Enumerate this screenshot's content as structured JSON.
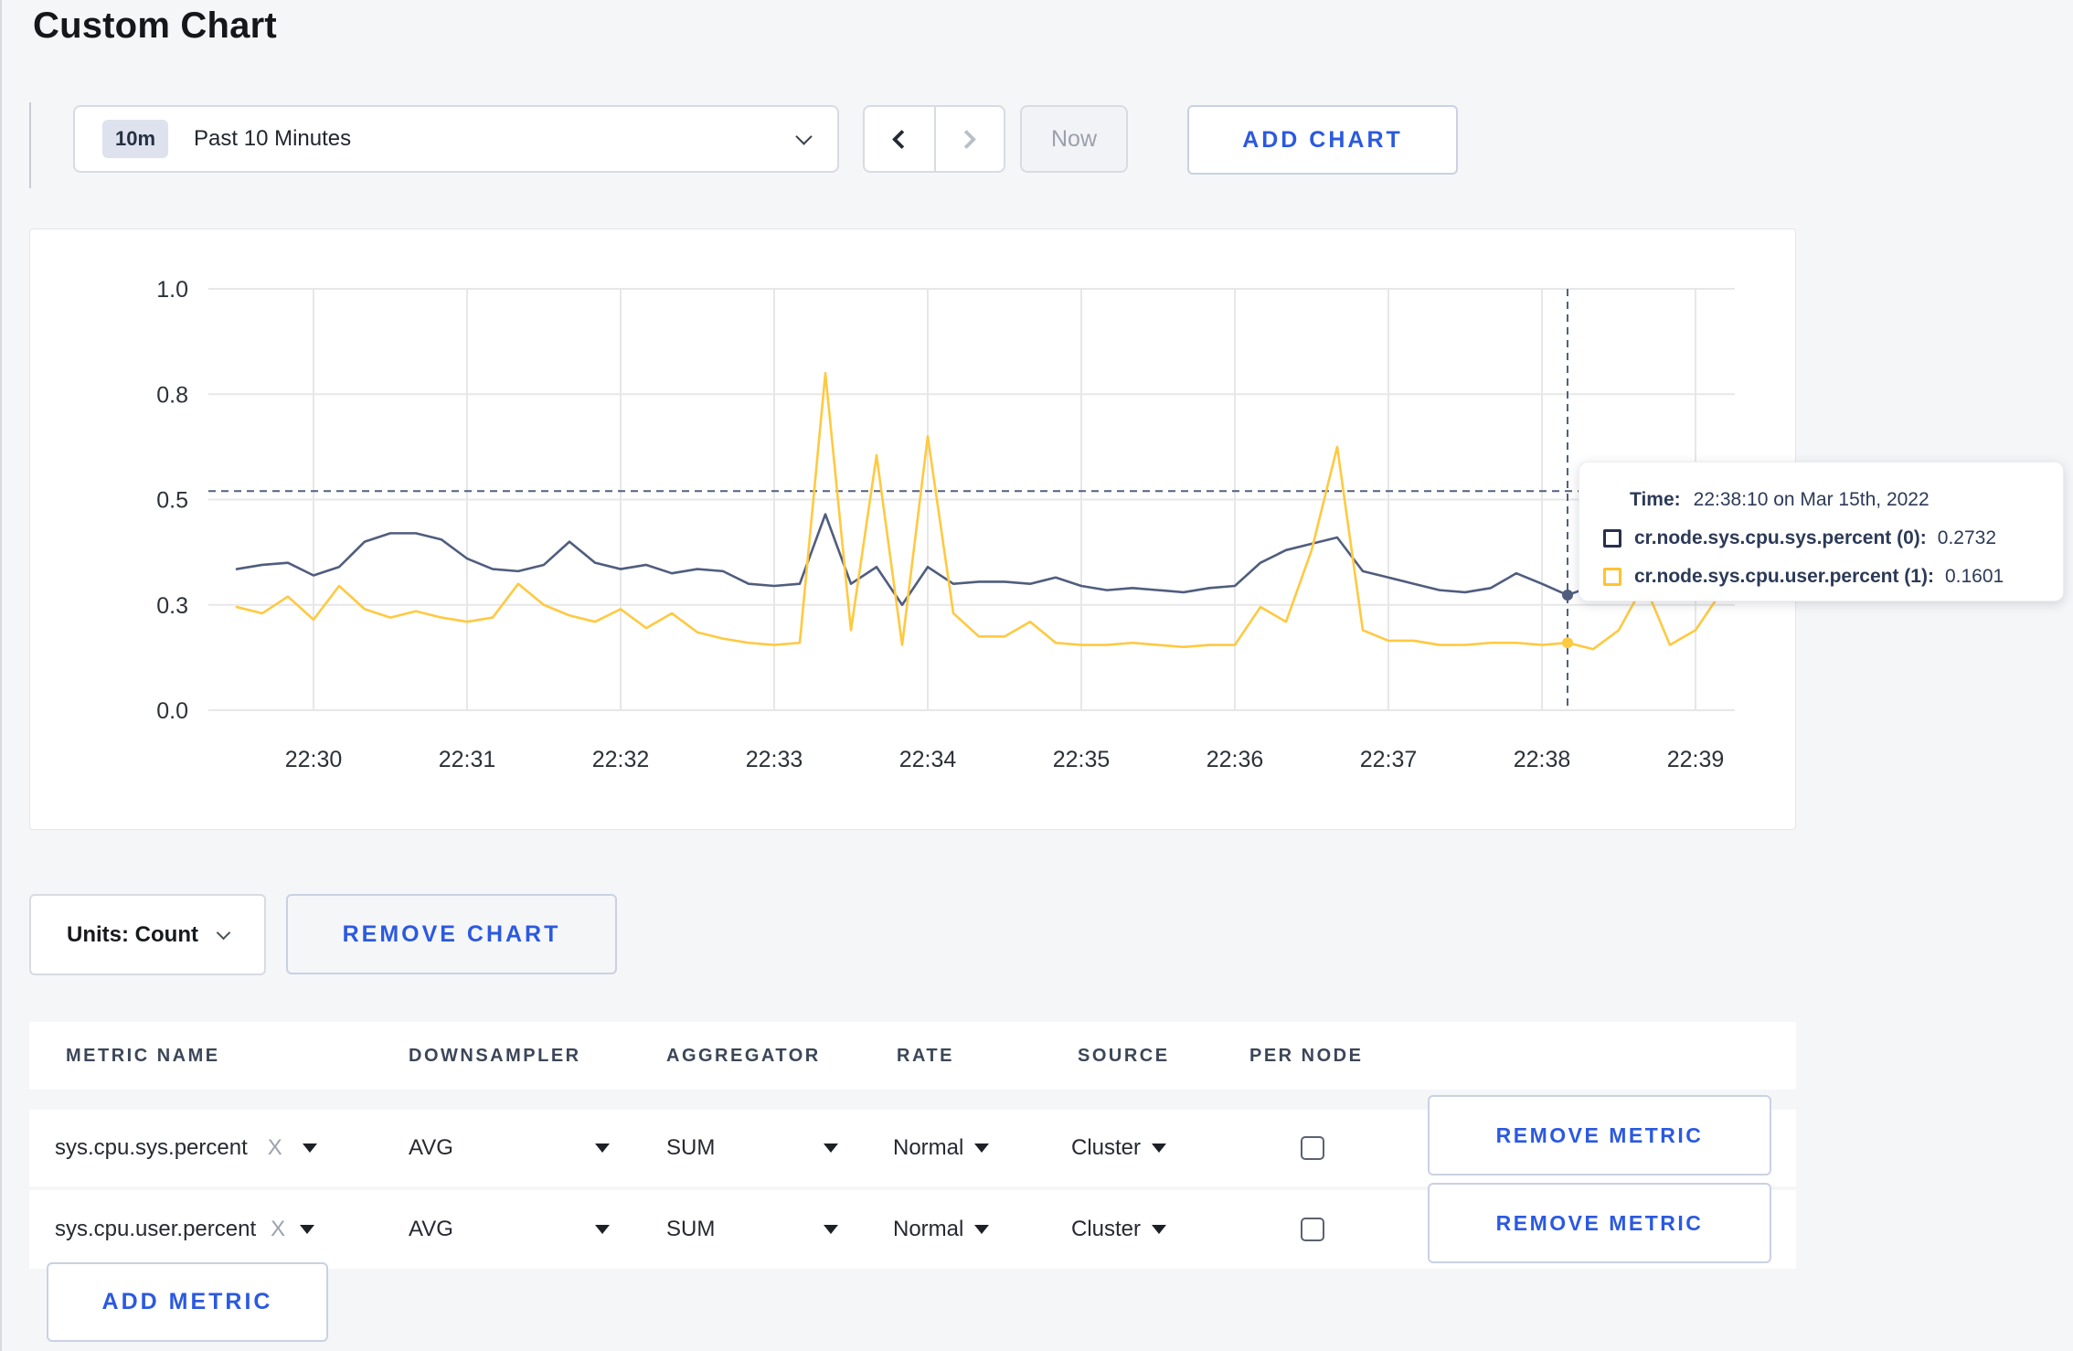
{
  "page": {
    "title": "Custom Chart"
  },
  "toolbar": {
    "time_range": {
      "badge": "10m",
      "label": "Past 10 Minutes"
    },
    "now_label": "Now",
    "add_chart_label": "ADD CHART"
  },
  "chart_controls": {
    "units_label": "Units: Count",
    "remove_chart_label": "REMOVE CHART"
  },
  "tooltip": {
    "time_label": "Time:",
    "time_value": "22:38:10 on Mar 15th, 2022",
    "series": [
      {
        "label": "cr.node.sys.cpu.sys.percent (0):",
        "value": "0.2732",
        "color": "#26304d"
      },
      {
        "label": "cr.node.sys.cpu.user.percent (1):",
        "value": "0.1601",
        "color": "#ffc32e"
      }
    ]
  },
  "chart_data": {
    "type": "line",
    "title": "",
    "xlabel": "",
    "ylabel": "",
    "ylim": [
      0,
      1
    ],
    "grid": true,
    "x_tick_labels": [
      "22:30",
      "22:31",
      "22:32",
      "22:33",
      "22:34",
      "22:35",
      "22:36",
      "22:37",
      "22:38",
      "22:39"
    ],
    "y_tick_labels": [
      "1.0",
      "0.8",
      "0.5",
      "0.3",
      "0.0"
    ],
    "y_tick_values": [
      1.0,
      0.75,
      0.5,
      0.25,
      0.0
    ],
    "start_time": "22:29:30",
    "interval_seconds": 10,
    "series": [
      {
        "name": "cr.node.sys.cpu.sys.percent (0)",
        "color": "#505d7e",
        "values": [
          0.335,
          0.345,
          0.35,
          0.32,
          0.34,
          0.4,
          0.42,
          0.42,
          0.405,
          0.36,
          0.335,
          0.33,
          0.345,
          0.4,
          0.35,
          0.335,
          0.345,
          0.325,
          0.335,
          0.33,
          0.3,
          0.295,
          0.3,
          0.465,
          0.3,
          0.34,
          0.25,
          0.34,
          0.3,
          0.305,
          0.305,
          0.3,
          0.315,
          0.295,
          0.285,
          0.29,
          0.285,
          0.28,
          0.29,
          0.295,
          0.35,
          0.38,
          0.395,
          0.41,
          0.33,
          0.315,
          0.3,
          0.285,
          0.28,
          0.29,
          0.325,
          0.3,
          0.2732,
          0.295,
          0.3,
          0.31,
          0.3,
          0.295,
          0.27
        ]
      },
      {
        "name": "cr.node.sys.cpu.user.percent (1)",
        "color": "#ffc940",
        "values": [
          0.245,
          0.23,
          0.27,
          0.215,
          0.295,
          0.24,
          0.22,
          0.235,
          0.22,
          0.21,
          0.22,
          0.3,
          0.25,
          0.225,
          0.21,
          0.24,
          0.195,
          0.23,
          0.185,
          0.17,
          0.16,
          0.155,
          0.16,
          0.8,
          0.19,
          0.605,
          0.155,
          0.65,
          0.23,
          0.175,
          0.175,
          0.21,
          0.16,
          0.155,
          0.155,
          0.16,
          0.155,
          0.15,
          0.155,
          0.155,
          0.245,
          0.21,
          0.38,
          0.625,
          0.19,
          0.165,
          0.165,
          0.155,
          0.155,
          0.16,
          0.16,
          0.155,
          0.1601,
          0.145,
          0.19,
          0.3,
          0.155,
          0.19,
          0.28
        ]
      }
    ],
    "crosshair": {
      "index": 52,
      "time": "22:38:10",
      "hline_value": 0.52
    },
    "legend_position": "tooltip"
  },
  "metrics_table": {
    "headers": [
      "METRIC NAME",
      "DOWNSAMPLER",
      "AGGREGATOR",
      "RATE",
      "SOURCE",
      "PER NODE"
    ],
    "rows": [
      {
        "metric": "sys.cpu.sys.percent",
        "close": "X",
        "downsampler": "AVG",
        "aggregator": "SUM",
        "rate": "Normal",
        "source": "Cluster",
        "per_node_checked": false
      },
      {
        "metric": "sys.cpu.user.percent",
        "close": "X",
        "downsampler": "AVG",
        "aggregator": "SUM",
        "rate": "Normal",
        "source": "Cluster",
        "per_node_checked": false
      }
    ],
    "remove_metric_label": "REMOVE METRIC",
    "add_metric_label": "ADD METRIC"
  }
}
